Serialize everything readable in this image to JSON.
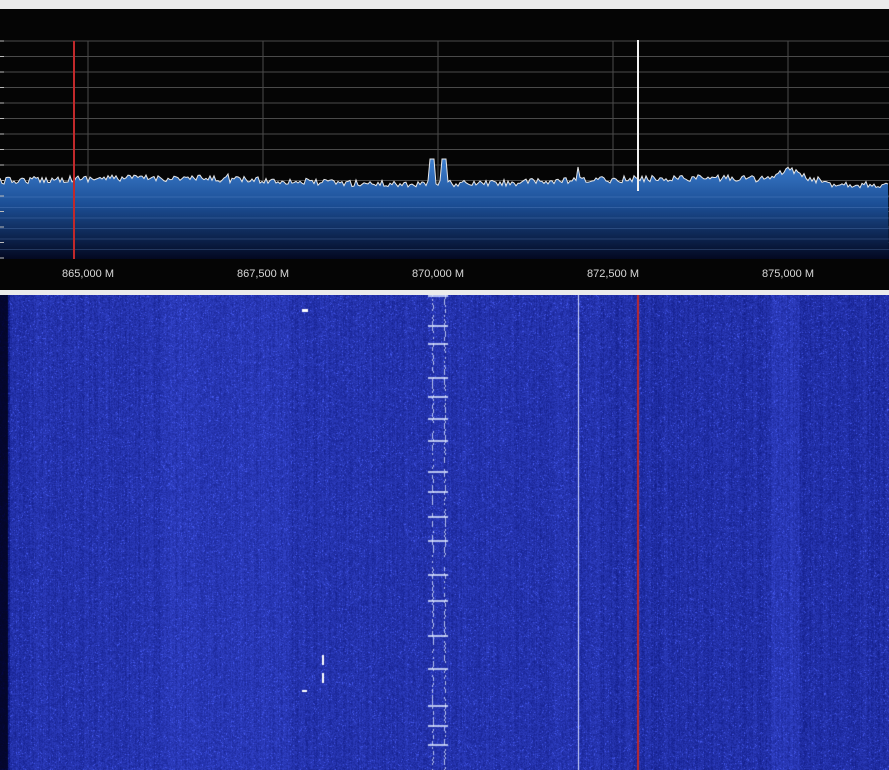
{
  "spectrum": {
    "freq_axis": {
      "labels": [
        "865,000 M",
        "867,500 M",
        "870,000 M",
        "872,500 M",
        "875,000 M"
      ]
    },
    "trace": {
      "fill_top": "#2f6fc0",
      "fill_bottom": "#050a28",
      "line": "#e8e8e8"
    },
    "markers": [
      "865.000 MHz tuning marker (red)",
      "872.850 MHz tuning marker (red)"
    ]
  },
  "colors": {
    "background": "#000000",
    "grid": "#5a5a5a",
    "marker": "#c0292b",
    "waterfall_base": "#0b1a8f",
    "separator": "#ebebeb"
  }
}
